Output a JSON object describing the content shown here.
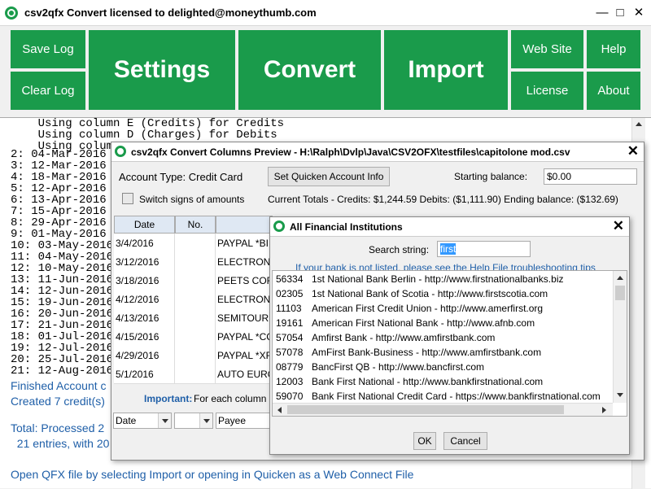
{
  "window": {
    "title": "csv2qfx Convert licensed to delighted@moneythumb.com",
    "minimize": "—",
    "maximize": "□",
    "close": "✕"
  },
  "toolbar": {
    "save_log": "Save Log",
    "clear_log": "Clear Log",
    "settings": "Settings",
    "convert": "Convert",
    "import": "Import",
    "web_site": "Web Site",
    "help": "Help",
    "license": "License",
    "about": "About",
    "button_color": "#1a9b4b"
  },
  "log": {
    "header_lines": [
      "    Using column E (Credits) for Credits",
      "    Using column D (Charges) for Debits",
      "    Using colum"
    ],
    "numbered_lines": [
      "2: 04-Mar-2016",
      "3: 12-Mar-2016",
      "4: 18-Mar-2016",
      "5: 12-Apr-2016",
      "6: 13-Apr-2016",
      "7: 15-Apr-2016",
      "8: 29-Apr-2016",
      "9: 01-May-2016",
      "10: 03-May-2016",
      "11: 04-May-2016",
      "12: 10-May-2016",
      "13: 11-Jun-2016",
      "14: 12-Jun-2016",
      "15: 19-Jun-2016",
      "16: 20-Jun-2016",
      "17: 21-Jun-2016",
      "18: 01-Jul-2016",
      "19: 12-Jul-2016",
      "20: 25-Jul-2016",
      "21: 12-Aug-2016"
    ],
    "finished": "Finished Account c",
    "created": "Created 7 credit(s)",
    "total": "Total: Processed 2",
    "entries": "  21 entries, with 20",
    "open_qfx": "Open QFX file by selecting Import or opening in Quicken as a Web Connect File",
    "text_color": "#1f5fa8"
  },
  "preview_dialog": {
    "title": "csv2qfx Convert Columns Preview - H:\\Ralph\\Dvlp\\Java\\CSV2OFX\\testfiles\\capitolone mod.csv",
    "close": "✕",
    "account_type_label": "Account Type: Credit Card",
    "set_quicken_button": "Set Quicken Account Info",
    "starting_balance_label": "Starting balance:",
    "starting_balance_value": "$0.00",
    "switch_signs_label": "Switch signs of amounts",
    "current_totals": "Current Totals - Credits: $1,244.59  Debits: ($1,111.90)   Ending balance: ($132.69)",
    "columns": [
      "Date",
      "No.",
      ""
    ],
    "rows": [
      {
        "date": "3/4/2016",
        "no": "",
        "payee": "PAYPAL *BI"
      },
      {
        "date": "3/12/2016",
        "no": "",
        "payee": "ELECTRON"
      },
      {
        "date": "3/18/2016",
        "no": "",
        "payee": "PEETS COF"
      },
      {
        "date": "4/12/2016",
        "no": "",
        "payee": "ELECTRON"
      },
      {
        "date": "4/13/2016",
        "no": "",
        "payee": "SEMITOUR"
      },
      {
        "date": "4/15/2016",
        "no": "",
        "payee": "PAYPAL *CC"
      },
      {
        "date": "4/29/2016",
        "no": "",
        "payee": "PAYPAL *XF"
      },
      {
        "date": "5/1/2016",
        "no": "",
        "payee": "AUTO EURO"
      }
    ],
    "important_label": "Important:",
    "important_text": "For each column",
    "mapping": [
      "Date",
      "",
      "Payee"
    ]
  },
  "fi_dialog": {
    "title": "All Financial Institutions",
    "close": "✕",
    "search_label": "Search string:",
    "search_value": "first",
    "help_link": "If your bank is not listed, please see the Help File troubleshooting tips",
    "items": [
      {
        "id": "56334",
        "name": "1st National Bank Berlin - http://www.firstnationalbanks.biz"
      },
      {
        "id": "02305",
        "name": "1st National Bank of Scotia - http://www.firstscotia.com"
      },
      {
        "id": "11103",
        "name": "American First Credit Union - http://www.amerfirst.org"
      },
      {
        "id": "19161",
        "name": "American First National Bank - http://www.afnb.com"
      },
      {
        "id": "57054",
        "name": "Amfirst Bank - http://www.amfirstbank.com"
      },
      {
        "id": "57078",
        "name": "AmFirst Bank-Business - http://www.amfirstbank.com"
      },
      {
        "id": "08779",
        "name": "BancFirst QB - http://www.bancfirst.com"
      },
      {
        "id": "12003",
        "name": "Bank First National - http://www.bankfirstnational.com"
      },
      {
        "id": "59070",
        "name": "Bank First National Credit Card - https://www.bankfirstnational.com"
      }
    ],
    "ok": "OK",
    "cancel": "Cancel",
    "link_color": "#1f5fa8"
  }
}
